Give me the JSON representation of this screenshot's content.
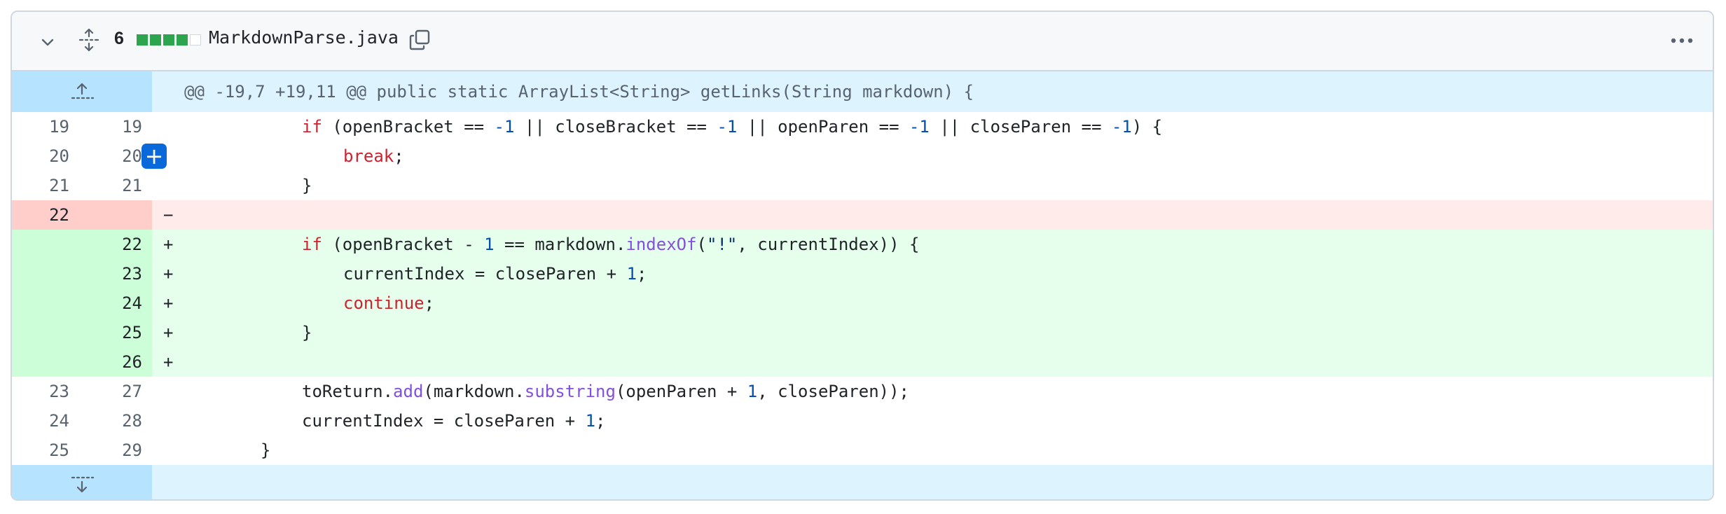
{
  "file": {
    "diff_count": "6",
    "diffstat": [
      "add",
      "add",
      "add",
      "add",
      "neutral"
    ],
    "name": "MarkdownParse.java",
    "colors": {
      "add": "#2da44e",
      "del_bg": "#ffebe9",
      "add_bg": "#e6ffec",
      "hunk_bg": "#ddf4ff",
      "expand": "#b6e3ff"
    }
  },
  "hunk": {
    "header": "@@ -19,7 +19,11 @@ public static ArrayList<String> getLinks(String markdown) {"
  },
  "lines": [
    {
      "old": "19",
      "new": "19",
      "marker": ""
    },
    {
      "old": "20",
      "new": "20",
      "marker": ""
    },
    {
      "old": "21",
      "new": "21",
      "marker": ""
    },
    {
      "old": "22",
      "new": "",
      "marker": "−"
    },
    {
      "old": "",
      "new": "22",
      "marker": "+"
    },
    {
      "old": "",
      "new": "23",
      "marker": "+"
    },
    {
      "old": "",
      "new": "24",
      "marker": "+"
    },
    {
      "old": "",
      "new": "25",
      "marker": "+"
    },
    {
      "old": "",
      "new": "26",
      "marker": "+"
    },
    {
      "old": "23",
      "new": "27",
      "marker": ""
    },
    {
      "old": "24",
      "new": "28",
      "marker": ""
    },
    {
      "old": "25",
      "new": "29",
      "marker": ""
    }
  ],
  "code": {
    "l1": {
      "kw1": "if",
      "a": " (openBracket == ",
      "n1": "-1",
      "b": " || closeBracket == ",
      "n2": "-1",
      "c": " || openParen == ",
      "n3": "-1",
      "d": " || closeParen == ",
      "n4": "-1",
      "e": ") {"
    },
    "l2": {
      "kw": "break",
      "semi": ";"
    },
    "l3": {
      "brace": "}"
    },
    "l5": {
      "kw": "if",
      "a": " (openBracket - ",
      "n": "1",
      "b": " == markdown.",
      "fn": "indexOf",
      "c": "(",
      "st": "\"!\"",
      "d": ", currentIndex)) {"
    },
    "l6": {
      "a": "currentIndex = closeParen + ",
      "n": "1",
      "b": ";"
    },
    "l7": {
      "kw": "continue",
      "semi": ";"
    },
    "l8": {
      "brace": "}"
    },
    "l10": {
      "a": "toReturn.",
      "fn1": "add",
      "b": "(markdown.",
      "fn2": "substring",
      "c": "(openParen + ",
      "n": "1",
      "d": ", closeParen));"
    },
    "l11": {
      "a": "currentIndex = closeParen + ",
      "n": "1",
      "b": ";"
    },
    "l12": {
      "brace": "}"
    }
  }
}
